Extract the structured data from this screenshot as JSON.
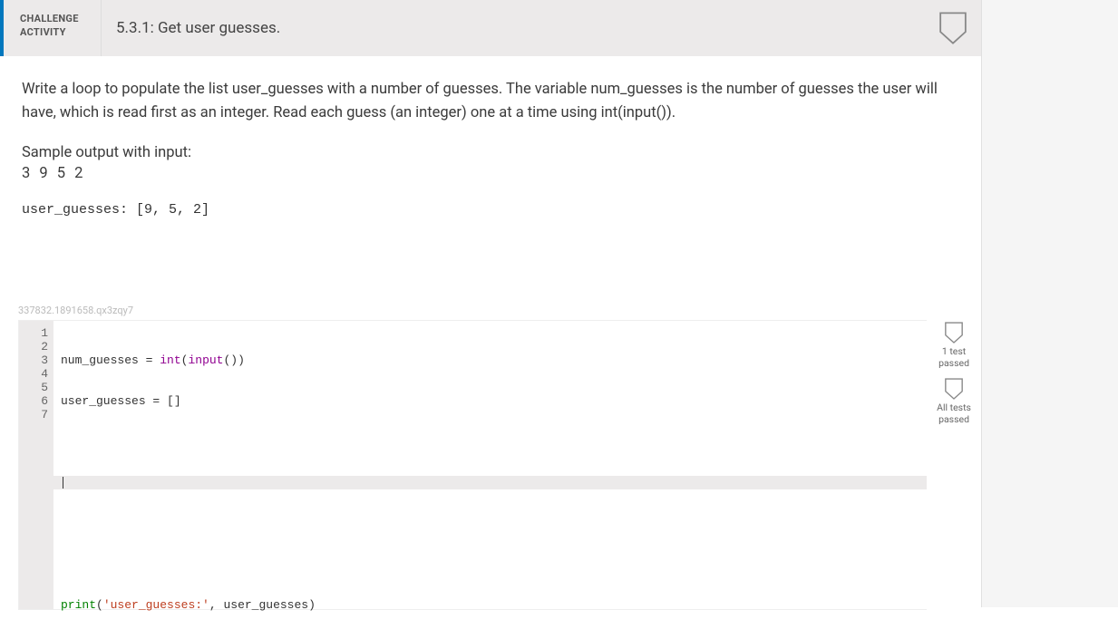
{
  "header": {
    "label_line1": "CHALLENGE",
    "label_line2": "ACTIVITY",
    "title": "5.3.1: Get user guesses."
  },
  "problem": {
    "description": "Write a loop to populate the list user_guesses with a number of guesses. The variable num_guesses is the number of guesses the user will have, which is read first as an integer. Read each guess (an integer) one at a time using int(input()).",
    "sample_label": "Sample output with input:",
    "sample_input": "3 9 5 2",
    "sample_output": "user_guesses: [9, 5, 2]"
  },
  "watermark": "337832.1891658.qx3zqy7",
  "code": {
    "line1_a": "num_guesses ",
    "line1_b": "=",
    "line1_c": " ",
    "line1_d": "int",
    "line1_e": "(",
    "line1_f": "input",
    "line1_g": "())",
    "line2_a": "user_guesses ",
    "line2_b": "=",
    "line2_c": " []",
    "line7_a": "print",
    "line7_b": "(",
    "line7_c": "'user_guesses:'",
    "line7_d": ", user_guesses)"
  },
  "gutter": [
    "1",
    "2",
    "3",
    "4",
    "5",
    "6",
    "7"
  ],
  "tests": {
    "one_test": "1 test",
    "passed1": "passed",
    "all_tests": "All tests",
    "passed2": "passed"
  }
}
